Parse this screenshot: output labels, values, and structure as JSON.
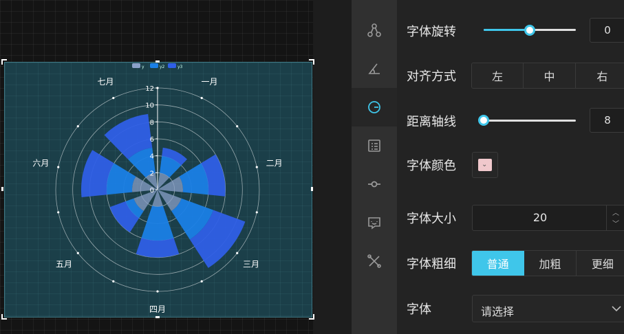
{
  "chart_data": {
    "type": "polar-bar",
    "categories": [
      "一月",
      "二月",
      "三月",
      "四月",
      "五月",
      "六月",
      "七月"
    ],
    "series": [
      {
        "name": "y",
        "values": [
          2,
          3,
          3,
          2,
          3,
          3,
          2
        ]
      },
      {
        "name": "y2",
        "values": [
          4,
          6,
          7,
          6,
          4,
          6,
          5
        ]
      },
      {
        "name": "y3",
        "values": [
          5,
          8,
          11,
          8,
          6,
          9,
          9
        ]
      }
    ],
    "radial_ticks": [
      "0",
      "2",
      "4",
      "6",
      "8",
      "10",
      "12"
    ],
    "rmax": 12,
    "colors": [
      "#8aa0c8",
      "#1a7fe6",
      "#2f5fe6"
    ]
  },
  "sidebar_icons": [
    "nodes-icon",
    "angle-icon",
    "polar-icon",
    "list-icon",
    "axis-line-icon",
    "chat-icon",
    "tools-icon"
  ],
  "panel": {
    "rotate_label": "字体旋转",
    "rotate_value": "0",
    "rotate_fraction": 0.5,
    "align_label": "对齐方式",
    "align_options": [
      "左",
      "中",
      "右"
    ],
    "distance_label": "距离轴线",
    "distance_value": "8",
    "distance_fraction": 0.0,
    "color_label": "字体颜色",
    "color_value": "#f0c8cc",
    "size_label": "字体大小",
    "size_value": "20",
    "weight_label": "字体粗细",
    "weight_options": [
      "普通",
      "加粗",
      "更细"
    ],
    "font_label": "字体",
    "font_placeholder": "请选择"
  }
}
